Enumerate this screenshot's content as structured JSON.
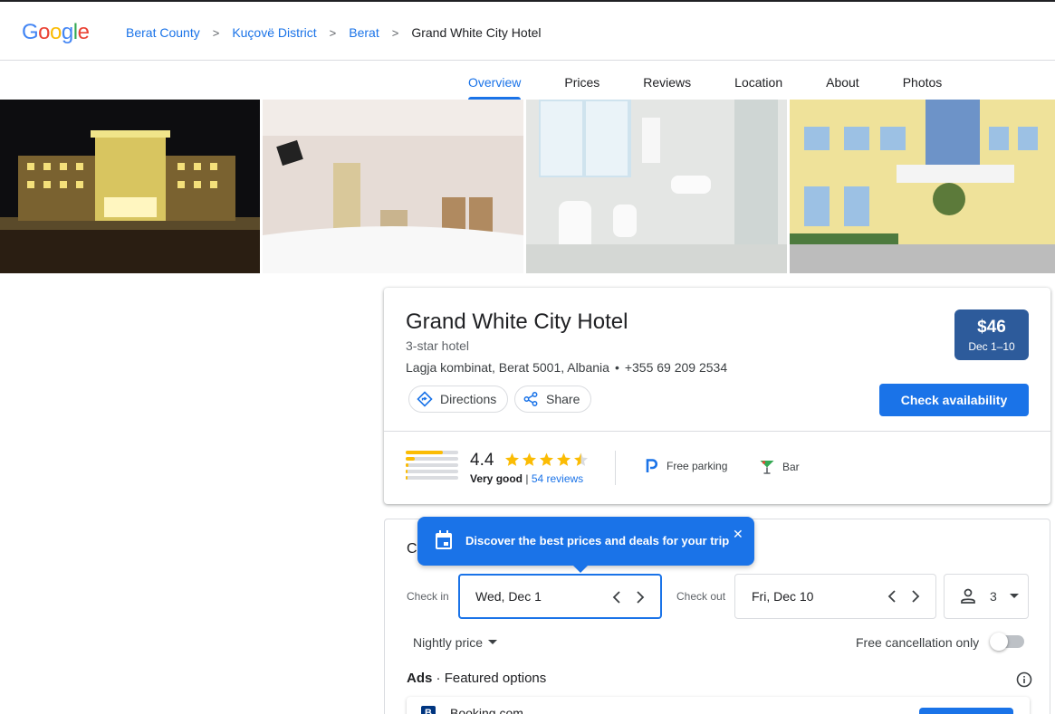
{
  "header": {
    "logo": "Google",
    "breadcrumbs": [
      "Berat County",
      "Kuçovë District",
      "Berat"
    ],
    "current": "Grand White City Hotel"
  },
  "tabs": [
    {
      "label": "Overview",
      "active": true
    },
    {
      "label": "Prices",
      "active": false
    },
    {
      "label": "Reviews",
      "active": false
    },
    {
      "label": "Location",
      "active": false
    },
    {
      "label": "About",
      "active": false
    },
    {
      "label": "Photos",
      "active": false
    }
  ],
  "hotel": {
    "name": "Grand White City Hotel",
    "class": "3-star hotel",
    "address": "Lagja kombinat, Berat 5001, Albania",
    "phone": "+355 69 209 2534",
    "directions_label": "Directions",
    "share_label": "Share",
    "price": "$46",
    "price_dates": "Dec 1–10",
    "check_label": "Check availability",
    "rating": "4.4",
    "rating_text": "Very good",
    "reviews_link": "54 reviews",
    "rating_distribution": [
      0.7,
      0.18,
      0.06,
      0.03,
      0.03
    ],
    "amenities": [
      {
        "label": "Free parking",
        "icon": "parking-icon"
      },
      {
        "label": "Bar",
        "icon": "cocktail-icon"
      }
    ]
  },
  "prices": {
    "title": "C",
    "tooltip": "Discover the best prices and deals for your trip",
    "checkin_label": "Check in",
    "checkin_value": "Wed, Dec 1",
    "checkout_label": "Check out",
    "checkout_value": "Fri, Dec 10",
    "guests": "3",
    "nightly_label": "Nightly price",
    "free_cancel_label": "Free cancellation only",
    "ads_prefix": "Ads",
    "ads_title": "Featured options",
    "offer_site": "Booking.com"
  },
  "colors": {
    "accent": "#1a73e8",
    "price_badge": "#2d5b9b",
    "star": "#fbbc04"
  }
}
